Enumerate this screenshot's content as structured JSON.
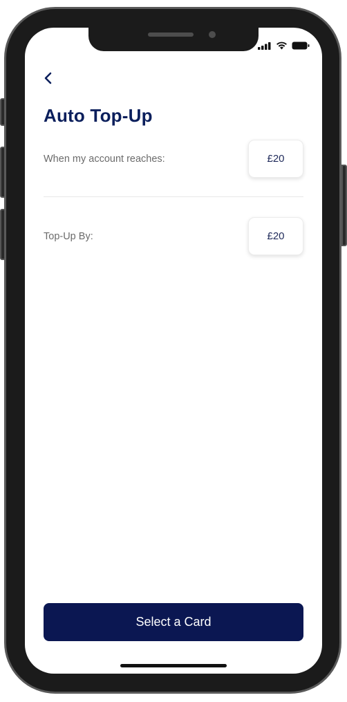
{
  "header": {
    "title": "Auto Top-Up",
    "back_icon": "chevron-left-icon"
  },
  "status_bar": {
    "icons": [
      "signal-icon",
      "wifi-icon",
      "battery-icon"
    ]
  },
  "rows": [
    {
      "label": "When my account reaches:",
      "value": "£20"
    },
    {
      "label": "Top-Up By:",
      "value": "£20"
    }
  ],
  "footer": {
    "primary_button": "Select a Card"
  },
  "colors": {
    "title": "#0b1f5c",
    "primary_button_bg": "#0b1752",
    "label": "#6b6b6b",
    "frame": "#1b1b1b"
  }
}
